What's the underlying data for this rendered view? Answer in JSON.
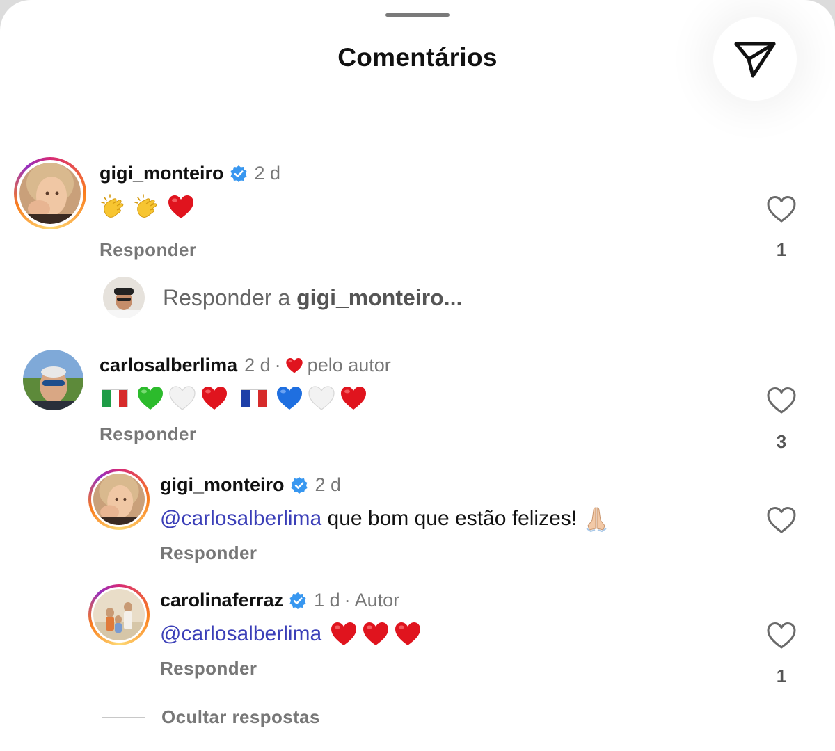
{
  "sheet": {
    "title": "Comentários"
  },
  "comments": [
    {
      "username": "gigi_monteiro",
      "verified": true,
      "time": "2 d",
      "reply_label": "Responder",
      "like_count": "1"
    },
    {
      "username": "carlosalberlima",
      "verified": false,
      "time": "2 d",
      "sep": "·",
      "liked_by_author": "pelo autor",
      "reply_label": "Responder",
      "like_count": "3"
    }
  ],
  "reply_input": {
    "prefix": "Responder a ",
    "target": "gigi_monteiro",
    "suffix": "..."
  },
  "replies": [
    {
      "username": "gigi_monteiro",
      "verified": true,
      "time": "2 d",
      "mention": "@carlosalberlima",
      "text": " que bom que estão felizes! ",
      "reply_label": "Responder"
    },
    {
      "username": "carolinaferraz",
      "verified": true,
      "time": "1 d",
      "sep": "·",
      "role": "Autor",
      "mention": "@carlosalberlima",
      "reply_label": "Responder",
      "like_count": "1"
    }
  ],
  "hide_replies_label": "Ocultar respostas",
  "colors": {
    "accent_mention": "#3b3fb8",
    "verified": "#3897f0",
    "heart": "#e0141e"
  },
  "icons": [
    "send-icon",
    "verified-badge-icon",
    "heart-outline-icon",
    "clapping-hands-emoji",
    "red-heart-emoji",
    "green-heart-emoji",
    "white-heart-emoji",
    "blue-heart-emoji",
    "italy-flag-emoji",
    "france-flag-emoji",
    "folded-hands-emoji"
  ]
}
